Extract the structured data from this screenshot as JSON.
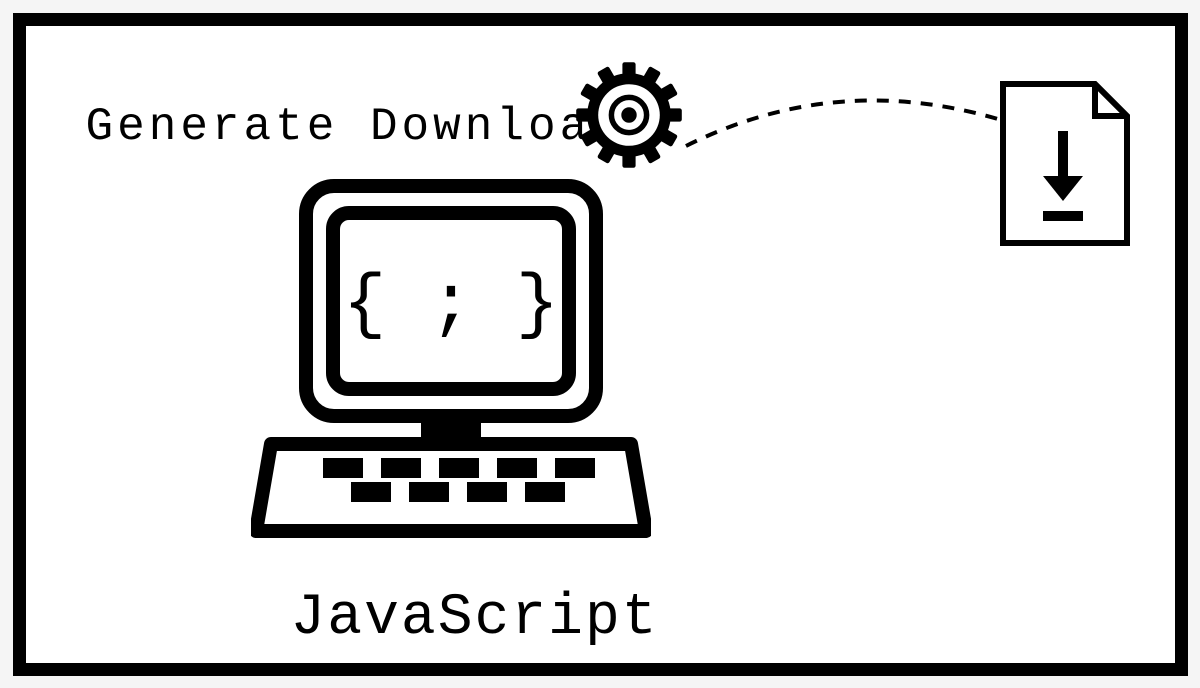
{
  "title": "Generate Download",
  "computer_label": "JavaScript",
  "code_on_screen": "{ ; }"
}
